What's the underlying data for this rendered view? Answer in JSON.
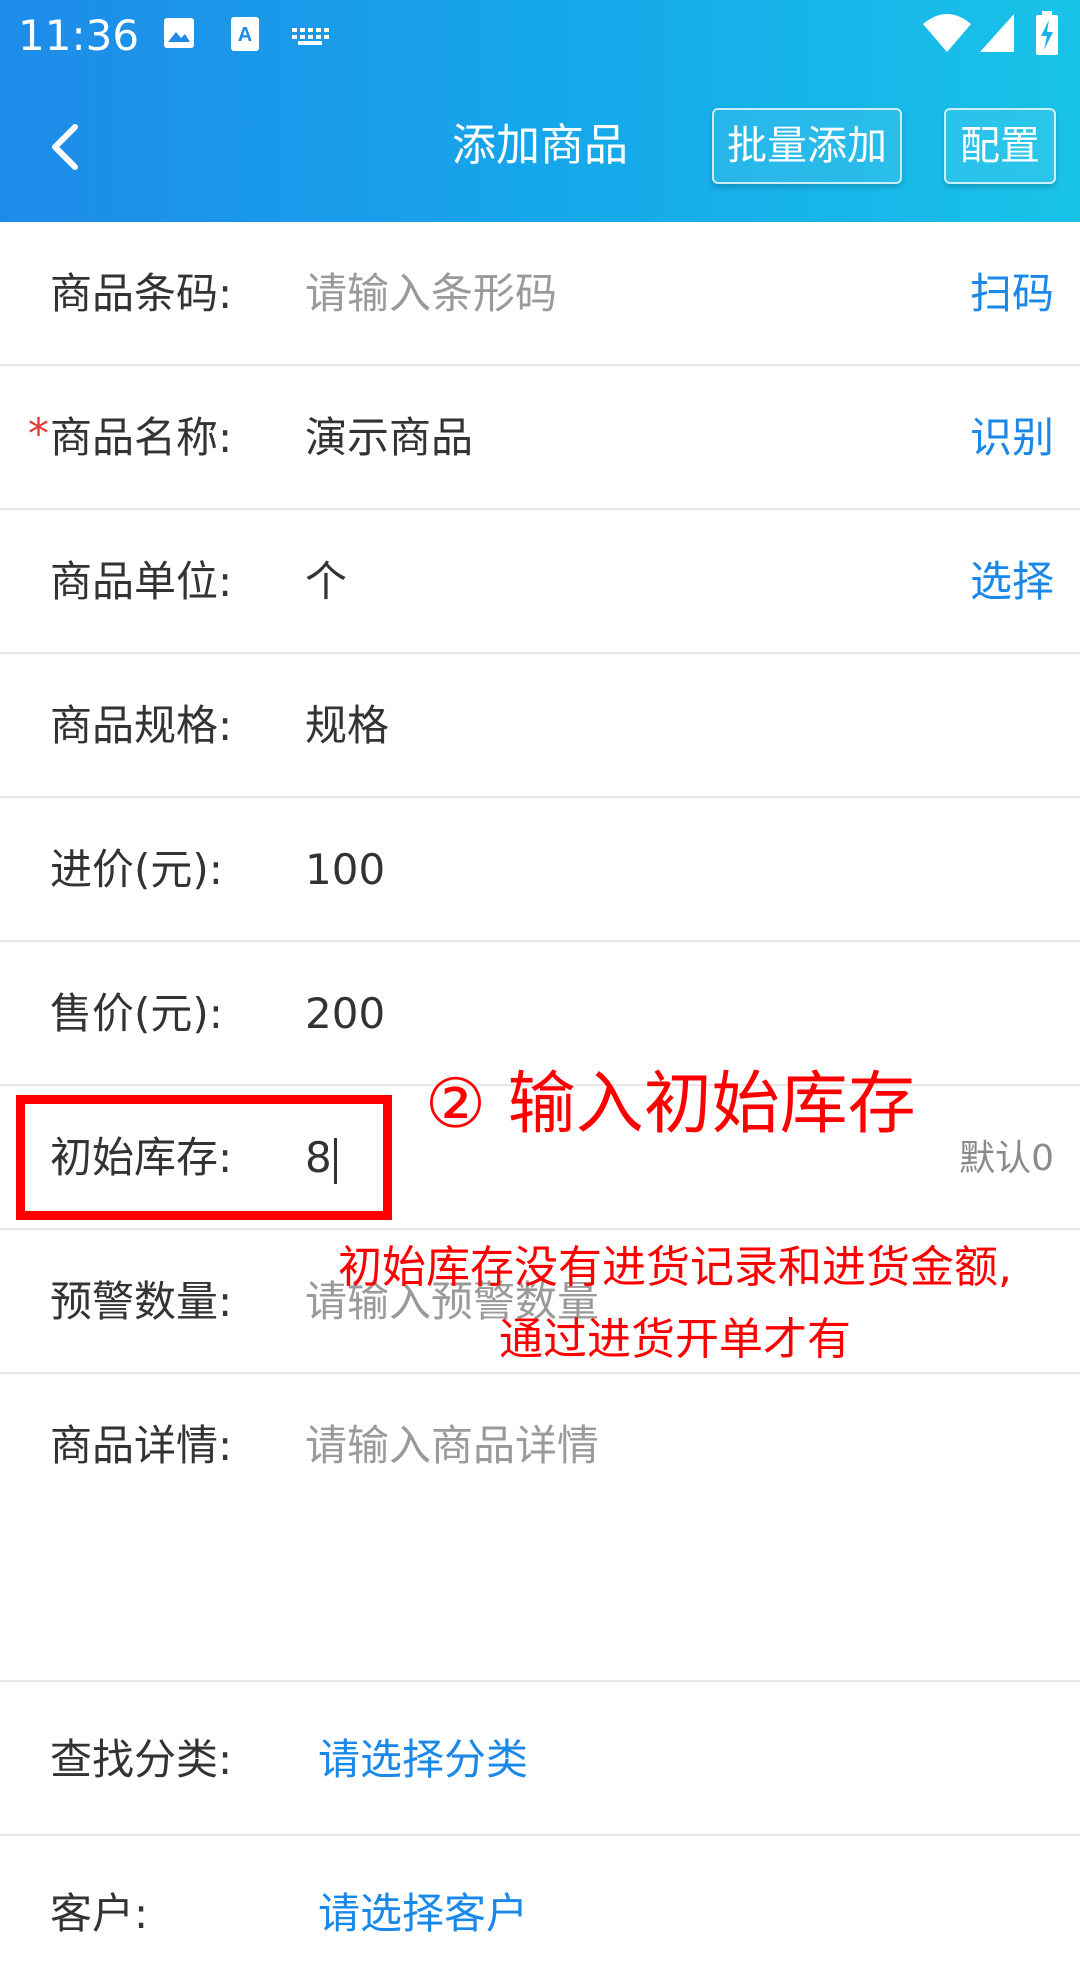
{
  "status_bar": {
    "time": "11:36",
    "left_icons": [
      "image-icon",
      "text-recognition-icon",
      "keyboard-icon"
    ],
    "right_icons": [
      "wifi-icon",
      "signal-icon",
      "battery-charging-icon"
    ]
  },
  "toolbar": {
    "title": "添加商品",
    "back_icon": "chevron-left-icon",
    "batch_add_label": "批量添加",
    "config_label": "配置"
  },
  "form": {
    "barcode": {
      "label": "商品条码:",
      "placeholder": "请输入条形码",
      "action": "扫码"
    },
    "name": {
      "required_mark": "*",
      "label": "商品名称:",
      "value": "演示商品",
      "action": "识别"
    },
    "unit": {
      "label": "商品单位:",
      "value": "个",
      "action": "选择"
    },
    "spec": {
      "label": "商品规格:",
      "value": "规格"
    },
    "purchase_price": {
      "label": "进价(元):",
      "value": "100"
    },
    "sale_price": {
      "label": "售价(元):",
      "value": "200"
    },
    "initial_stock": {
      "label": "初始库存:",
      "value": "8",
      "hint": "默认0"
    },
    "warning_qty": {
      "label": "预警数量:",
      "placeholder": "请输入预警数量"
    },
    "details": {
      "label": "商品详情:",
      "placeholder": "请输入商品详情"
    },
    "category": {
      "label": "查找分类:",
      "value": "请选择分类"
    },
    "customer": {
      "label": "客户:",
      "value": "请选择客户"
    }
  },
  "annotations": {
    "step_title": "② 输入初始库存",
    "note_line1": "初始库存没有进货记录和进货金额,",
    "note_line2": "通过进货开单才有",
    "color": "#ff0000"
  },
  "colors": {
    "header_gradient_start": "#1e8be9",
    "header_gradient_end": "#19c3e8",
    "link_blue": "#1a88e8",
    "required_red": "#e53935"
  }
}
